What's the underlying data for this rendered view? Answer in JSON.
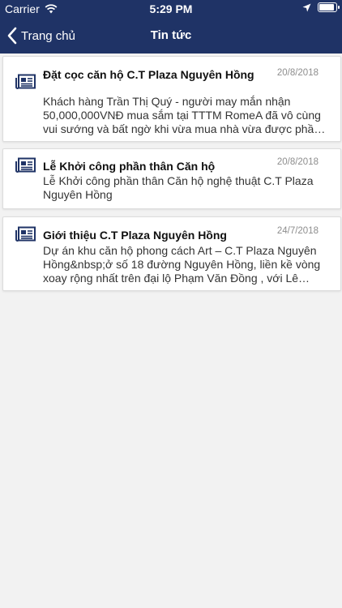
{
  "status_bar": {
    "carrier": "Carrier",
    "time": "5:29 PM"
  },
  "nav": {
    "back_label": "Trang chủ",
    "title": "Tin tức"
  },
  "news": [
    {
      "title": "Đặt cọc căn hộ C.T Plaza Nguyên Hồng",
      "date": "20/8/2018",
      "summary": "Khách hàng Trần Thị Quý - người may mắn nhận 50,000,000VNĐ mua sắm tại TTTM RomeA đã vô cùng vui sướng và bất ngờ khi vừa mua nhà vừa được phần thưởng lớn"
    },
    {
      "title": "Lễ Khởi công phần thân Căn hộ",
      "date": "20/8/2018",
      "summary": "Lễ Khởi công phần thân Căn hộ nghệ thuật C.T Plaza Nguyên Hồng"
    },
    {
      "title": "Giới thiệu C.T Plaza Nguyên Hồng",
      "date": "24/7/2018",
      "summary": "Dự án khu căn hộ phong cách Art – C.T Plaza Nguyên Hồng&nbsp;ở số 18 đường Nguyên Hồng, liền kề vòng xoay rộng nhất trên đại lộ Phạm Văn Đồng , với Lê Quang Định"
    }
  ]
}
